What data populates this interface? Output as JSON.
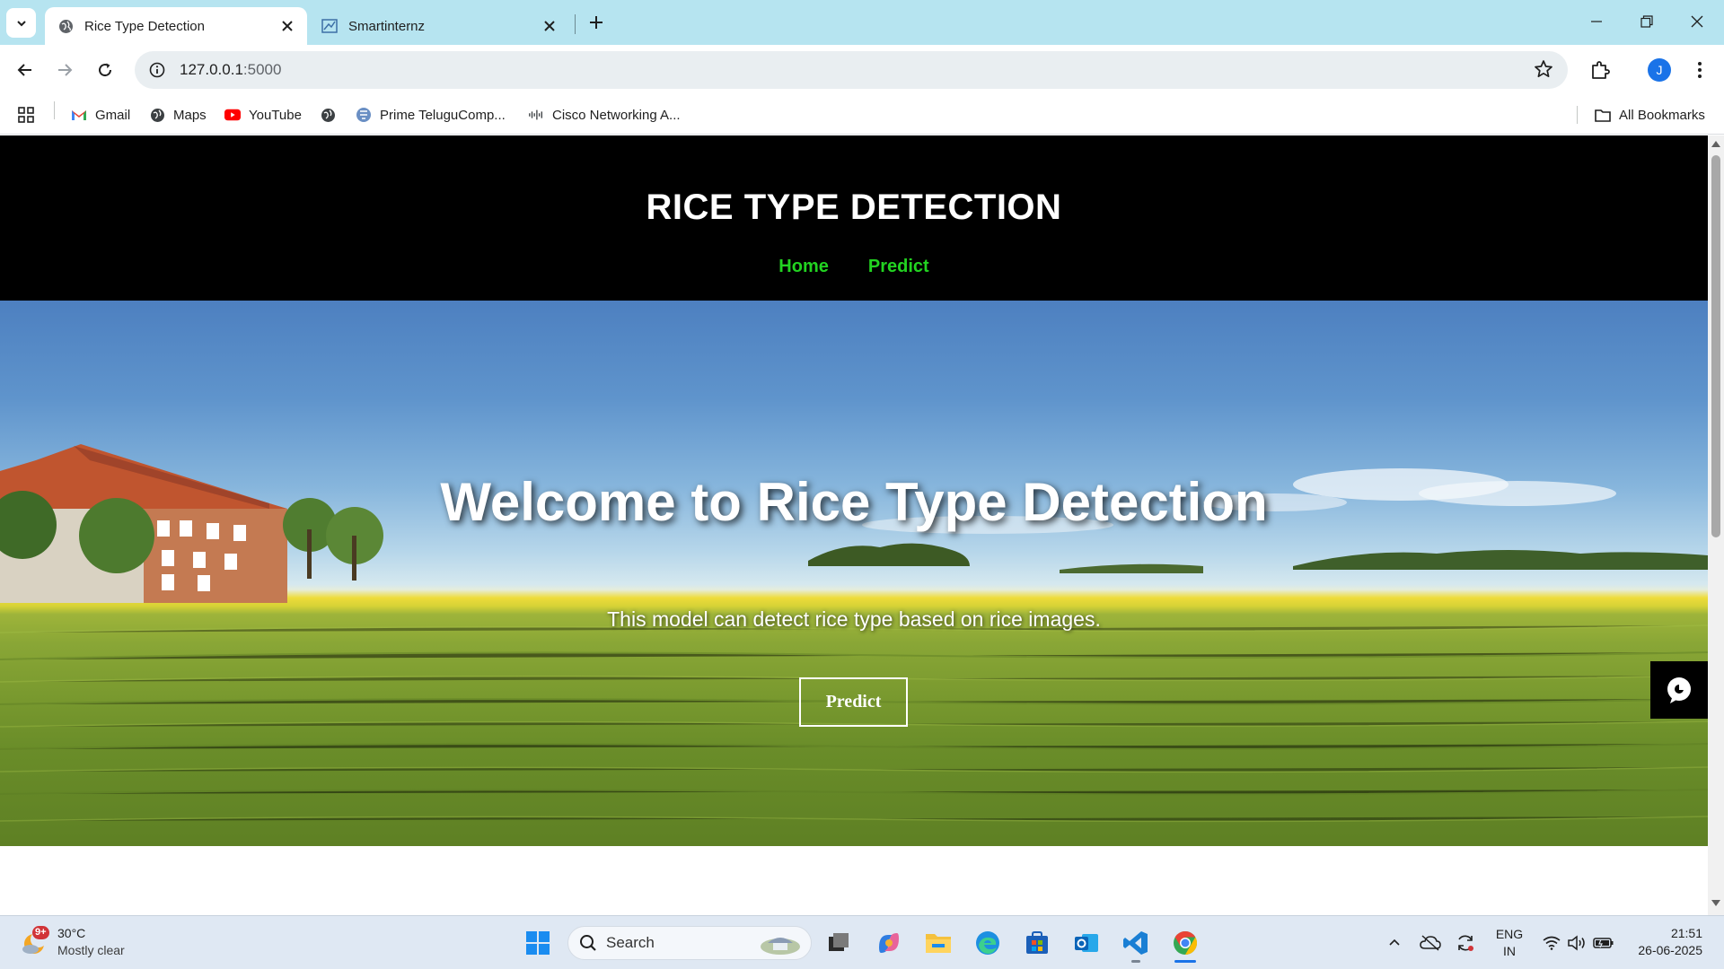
{
  "browser": {
    "tabs": [
      {
        "title": "Rice Type Detection",
        "active": true
      },
      {
        "title": "Smartinternz",
        "active": false
      }
    ],
    "url_host": "127.0.0.1",
    "url_port": ":5000",
    "profile_initial": "J",
    "bookmarks": [
      {
        "label": "Gmail",
        "icon": "gmail-icon"
      },
      {
        "label": "Maps",
        "icon": "globe-icon"
      },
      {
        "label": "YouTube",
        "icon": "youtube-icon"
      },
      {
        "label": "",
        "icon": "globe-icon"
      },
      {
        "label": "Prime TeluguComp...",
        "icon": "site-icon"
      },
      {
        "label": "Cisco Networking A...",
        "icon": "cisco-icon"
      }
    ],
    "all_bookmarks_label": "All Bookmarks"
  },
  "site": {
    "title": "RICE TYPE DETECTION",
    "nav": [
      "Home",
      "Predict"
    ],
    "nav_color": "#22d321",
    "hero_heading": "Welcome to Rice Type Detection",
    "hero_subtitle": "This model can detect rice type based on rice images.",
    "hero_button": "Predict"
  },
  "taskbar": {
    "weather_temp": "30°C",
    "weather_desc": "Mostly clear",
    "weather_badge": "9+",
    "search_label": "Search",
    "language_line1": "ENG",
    "language_line2": "IN",
    "time": "21:51",
    "date": "26-06-2025"
  }
}
